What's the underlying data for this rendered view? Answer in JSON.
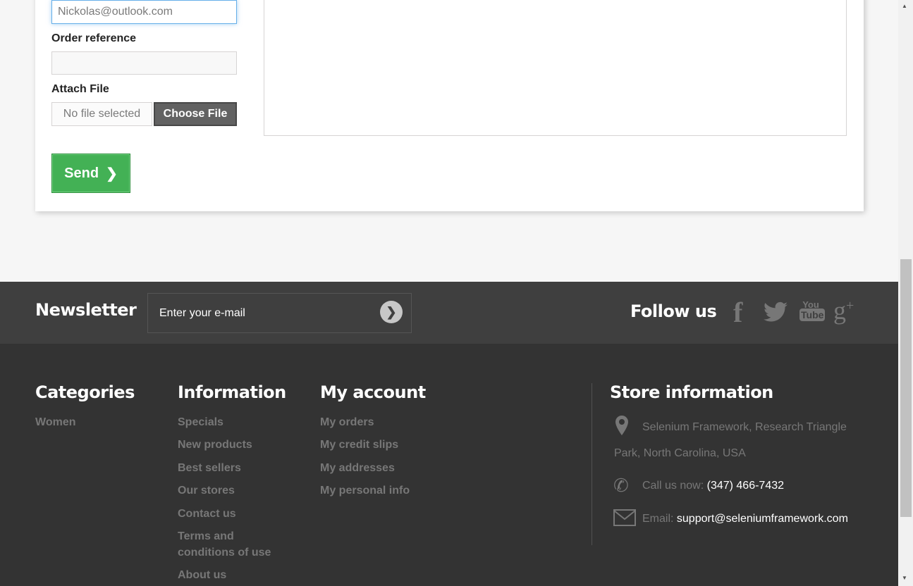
{
  "form": {
    "email_value": "Nickolas@outlook.com",
    "order_ref_label": "Order reference",
    "order_ref_value": "",
    "attach_label": "Attach File",
    "no_file": "No file selected",
    "choose_file": "Choose File",
    "send": "Send"
  },
  "newsletter": {
    "title": "Newsletter",
    "placeholder": "Enter your e-mail"
  },
  "follow": {
    "title": "Follow us",
    "icons": [
      "facebook-icon",
      "twitter-icon",
      "youtube-icon",
      "google-plus-icon"
    ]
  },
  "footer": {
    "categories": {
      "title": "Categories",
      "items": [
        "Women"
      ]
    },
    "information": {
      "title": "Information",
      "items": [
        "Specials",
        "New products",
        "Best sellers",
        "Our stores",
        "Contact us",
        "Terms and conditions of use",
        "About us"
      ]
    },
    "account": {
      "title": "My account",
      "items": [
        "My orders",
        "My credit slips",
        "My addresses",
        "My personal info"
      ]
    },
    "store": {
      "title": "Store information",
      "address_line1": "Selenium Framework, Research Triangle",
      "address_line2": "Park, North Carolina, USA",
      "call_label": "Call us now:",
      "phone": "(347) 466-7432",
      "email_label": "Email:",
      "email": "support@seleniumframework.com"
    }
  }
}
